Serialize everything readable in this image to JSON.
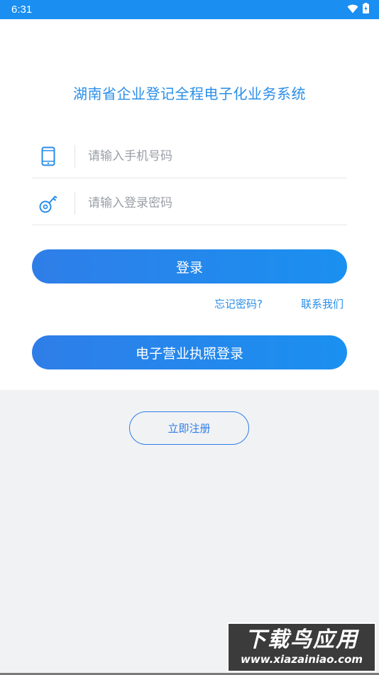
{
  "status_bar": {
    "time": "6:31",
    "icons": [
      "wifi-icon",
      "battery-charging-icon"
    ]
  },
  "app": {
    "title": "湖南省企业登记全程电子化业务系统"
  },
  "form": {
    "phone_placeholder": "请输入手机号码",
    "phone_value": "",
    "phone_icon": "mobile-phone-icon",
    "password_placeholder": "请输入登录密码",
    "password_value": "",
    "password_icon": "key-icon"
  },
  "actions": {
    "login_label": "登录",
    "forgot_password_label": "忘记密码?",
    "contact_us_label": "联系我们",
    "license_login_label": "电子营业执照登录",
    "register_label": "立即注册"
  },
  "watermark": {
    "title": "下载鸟应用",
    "url": "www.xiazainiao.com"
  },
  "colors": {
    "accent": "#2a8ee8",
    "status_bar": "#1a8ef1",
    "button_gradient_start": "#2f7ee8",
    "button_gradient_end": "#1a90f0",
    "page_background": "#f1f2f4"
  }
}
